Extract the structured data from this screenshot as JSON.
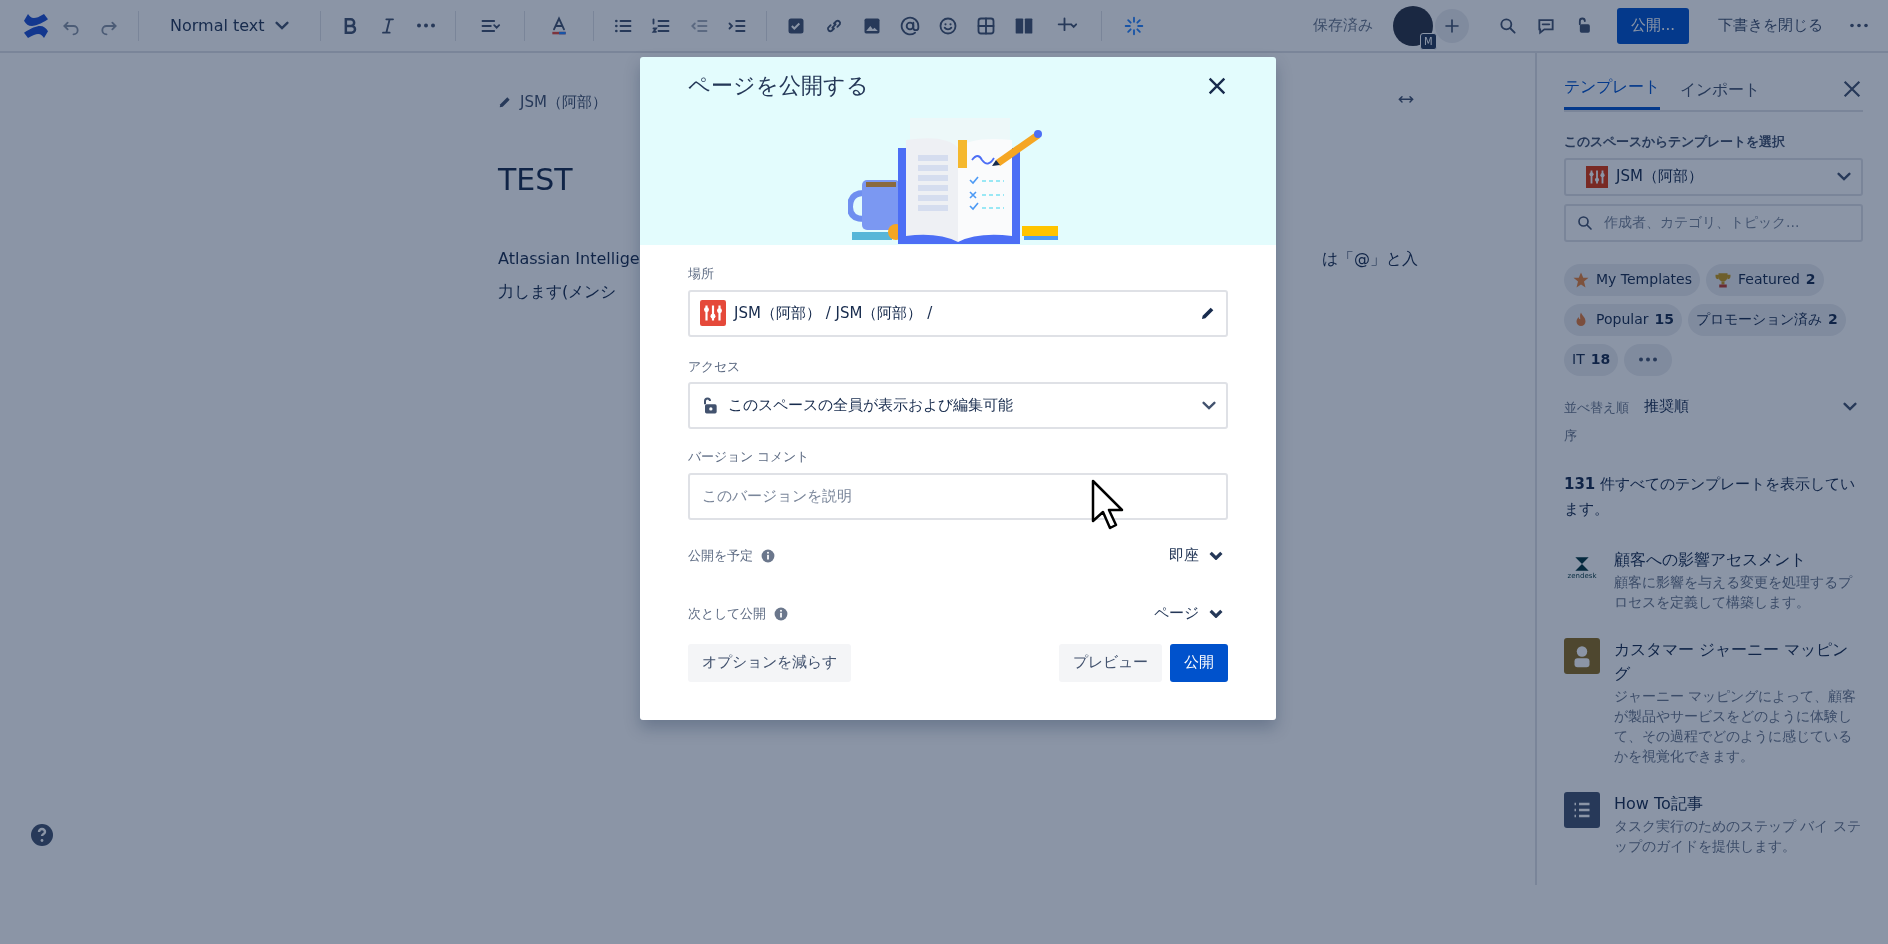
{
  "toolbar": {
    "text_style": "Normal text",
    "saved_status": "保存済み",
    "avatar_badge": "M",
    "publish_button": "公開...",
    "close_draft_button": "下書きを閉じる"
  },
  "editor": {
    "breadcrumb": "JSM（阿部）",
    "title": "TEST",
    "lines": [
      {
        "left": "Atlassian Intellige",
        "right": "は「@」と入"
      },
      {
        "left": "力します(メンシ"
      }
    ]
  },
  "dialog": {
    "title": "ページを公開する",
    "location": {
      "label": "場所",
      "value": "JSM（阿部） / JSM（阿部） /"
    },
    "access": {
      "label": "アクセス",
      "value": "このスペースの全員が表示および編集可能"
    },
    "version_comment": {
      "label": "バージョン コメント",
      "placeholder": "このバージョンを説明"
    },
    "options": [
      {
        "label": "公開を予定",
        "value": "即座"
      },
      {
        "label": "次として公開",
        "value": "ページ"
      }
    ],
    "buttons": [
      {
        "label": "オプションを減らす",
        "kind": "secondary"
      },
      {
        "label": "プレビュー",
        "kind": "secondary"
      },
      {
        "label": "公開",
        "kind": "primary"
      }
    ]
  },
  "sidebar": {
    "tabs": [
      {
        "label": "テンプレート",
        "selected": true
      },
      {
        "label": "インポート",
        "selected": false
      }
    ],
    "space_label": "このスペースからテンプレートを選択",
    "space_value": "JSM（阿部）",
    "search": {
      "placeholder": "作成者、カテゴリ、トピック..."
    },
    "chips": [
      {
        "kind": "star",
        "label": "My Templates"
      },
      {
        "kind": "trophy",
        "label": "Featured",
        "count": "2"
      },
      {
        "kind": "fire",
        "label": "Popular",
        "count": "15"
      },
      {
        "kind": "plain",
        "label": "プロモーション済み",
        "count": "2"
      },
      {
        "kind": "plain",
        "label": "IT",
        "count": "18"
      },
      {
        "kind": "more"
      }
    ],
    "sort_label": "並べ替え順序",
    "sort_value": "推奨順",
    "count_text": "**131** 件すべてのテンプレートを表示しています。",
    "templates": [
      {
        "kind": "zendesk",
        "icon_text": "zendesk",
        "title": "顧客への影響アセスメント",
        "description": "顧客に影響を与える変更を処理するプロセスを定義して構築します。"
      },
      {
        "kind": "person",
        "title": "カスタマー ジャーニー マッピング",
        "description": "ジャーニー マッピングによって、顧客が製品やサービスをどのように体験して、その過程でどのように感じているかを視覚化できます。"
      },
      {
        "kind": "list",
        "title": "How To記事",
        "description": "タスク実行のためのステップ バイ ステップのガイドを提供します。"
      }
    ]
  }
}
